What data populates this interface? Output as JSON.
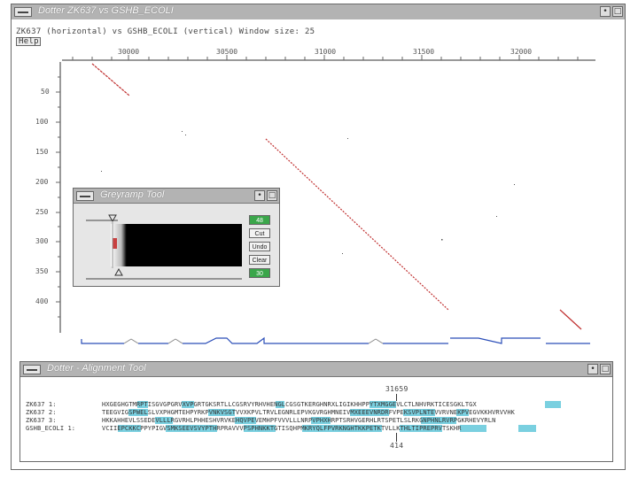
{
  "main_window": {
    "title": "Dotter ZK637 vs GSHB_ECOLI",
    "info_line": "ZK637 (horizontal) vs GSHB_ECOLI (vertical) Window size: 25",
    "menu_label": "Help",
    "x_ticks": [
      "30000",
      "30500",
      "31000",
      "31500",
      "32000"
    ],
    "y_ticks": [
      "50",
      "100",
      "150",
      "200",
      "250",
      "300",
      "350",
      "400"
    ]
  },
  "greyramp_tool": {
    "title": "Greyramp Tool",
    "buttons": {
      "top": "48",
      "cut": "Cut",
      "undo": "Undo",
      "clear": "Clear",
      "bottom": "30"
    }
  },
  "alignment_tool": {
    "title": "Dotter - Alignment Tool",
    "top_position": "31659",
    "bottom_position": "414",
    "rows": [
      {
        "label": "ZK637 1:",
        "sequence": "HXGEGHGTMRPTISGVGPGRVXVPGRTGKSRTLLCGSRVYRHVHENGLCGSGTKERGHNRXLIGIKHHPPYTXMGGEVLCTLNHVRKTICESGKLTGX"
      },
      {
        "label": "ZK637 2:",
        "sequence": "TEEGVIGSPWELSLVXPHGMTEHPYRKPVNKVSGTVVXKPVLTRVLEGNRLEPVKGVRGHMNEIVMXEEEVNRDRFVPEKSVPLNTEVVRVNEKPVEGVKKHVRVVHK"
      },
      {
        "label": "ZK637 3:",
        "sequence": "HKKAHHEVLSSEDEVLLLRGVRHLPHHESHVRVKEHQVPEVEMHPFVVVLLLNRPVPHXHRPTSRHVGERHLRTSPETLSLRKGNPHNLRVRPGKRHEVYRLN"
      },
      {
        "label": "GSHB_ECOLI 1:",
        "sequence": "VCIIEPCKKCPPYPIGVSMKSEEVSVYPTHRPRAVVVPSPHNKKTGTISQHPMKRYQLFPVRKNGHTKKPETKTVLLKTHLTIPREPRVTSKHR"
      }
    ]
  }
}
